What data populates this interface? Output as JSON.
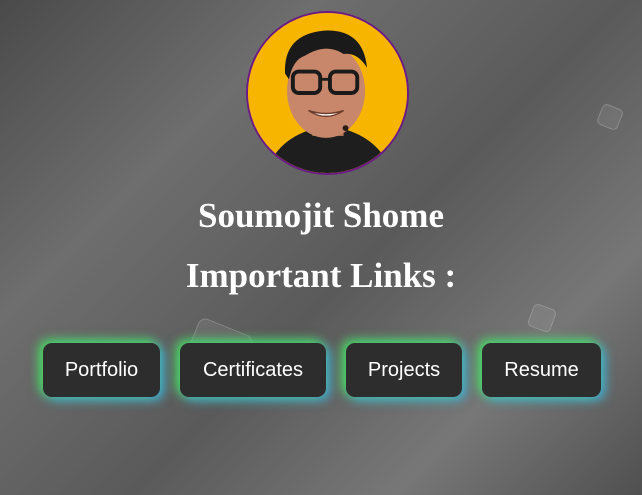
{
  "profile": {
    "name": "Soumojit Shome",
    "subtitle": "Important Links :",
    "avatar_bg": "#f7b500",
    "avatar_border": "#6b1a86"
  },
  "links": [
    {
      "label": "Portfolio"
    },
    {
      "label": "Certificates"
    },
    {
      "label": "Projects"
    },
    {
      "label": "Resume"
    }
  ],
  "colors": {
    "button_bg": "#2d2d2d",
    "glow_green": "#46e15a",
    "glow_blue": "#3caae6",
    "text": "#ffffff"
  }
}
